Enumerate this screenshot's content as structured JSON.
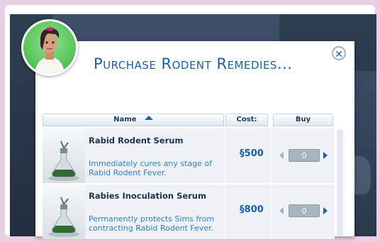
{
  "dialog": {
    "title": "Purchase Rodent Remedies...",
    "close_icon": "close-icon"
  },
  "table": {
    "headers": {
      "name": "Name",
      "cost": "Cost:",
      "buy": "Buy"
    },
    "sort_icon": "sort-ascending-icon"
  },
  "items": [
    {
      "name": "Rabid Rodent Serum",
      "description": "Immediately cures any stage of Rabid Rodent Fever.",
      "price": "500",
      "quantity": "0",
      "icon": "serum-flask-icon"
    },
    {
      "name": "Rabies Inoculation Serum",
      "description": "Permanently protects Sims from contracting Rabid Rodent Fever.",
      "price": "800",
      "quantity": "0",
      "icon": "serum-flask-icon"
    }
  ],
  "colors": {
    "accent": "#1d5ea8",
    "description": "#2f7fd0",
    "page_border": "#e9cfe3"
  }
}
